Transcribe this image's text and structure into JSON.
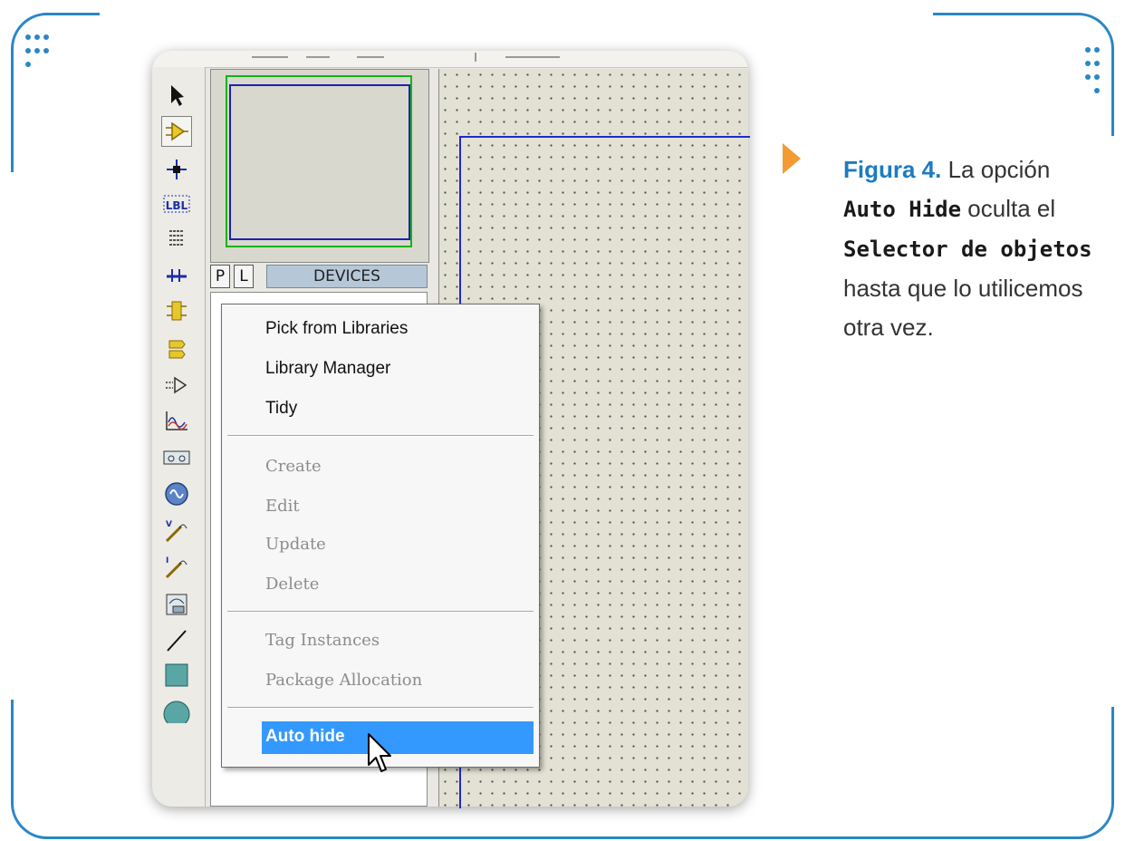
{
  "caption": {
    "figure_label": "Figura 4.",
    "text_1": "La opción",
    "code_1": "Auto Hide",
    "text_2": "oculta el",
    "code_2": "Selector de objetos",
    "text_3": "hasta que lo utilicemos otra vez."
  },
  "object_selector": {
    "tab_p": "P",
    "tab_l": "L",
    "title": "DEVICES"
  },
  "context_menu": {
    "items": [
      {
        "label": "Pick from Libraries",
        "enabled": true
      },
      {
        "label": "Library Manager",
        "enabled": true
      },
      {
        "label": "Tidy",
        "enabled": true
      },
      {
        "label": "Create",
        "enabled": false
      },
      {
        "label": "Edit",
        "enabled": false
      },
      {
        "label": "Update",
        "enabled": false
      },
      {
        "label": "Delete",
        "enabled": false
      },
      {
        "label": "Tag Instances",
        "enabled": false
      },
      {
        "label": "Package Allocation",
        "enabled": false
      },
      {
        "label": "Auto hide",
        "enabled": true,
        "highlighted": true
      }
    ]
  },
  "toolbar": {
    "icons": [
      "selection-mode-icon",
      "component-mode-icon",
      "junction-dot-icon",
      "wire-label-icon",
      "text-script-icon",
      "buses-icon",
      "subcircuit-icon",
      "terminals-icon",
      "device-pins-icon",
      "graph-icon",
      "tape-recorder-icon",
      "generator-icon",
      "voltage-probe-icon",
      "current-probe-icon",
      "virtual-instruments-icon",
      "line-icon",
      "box-icon",
      "circle-icon"
    ],
    "selected": "component-mode-icon",
    "label_icon_text": "LBL"
  },
  "colors": {
    "accent_blue": "#2a87c7",
    "arrow_orange": "#f39b32",
    "menu_highlight": "#3399ff"
  }
}
